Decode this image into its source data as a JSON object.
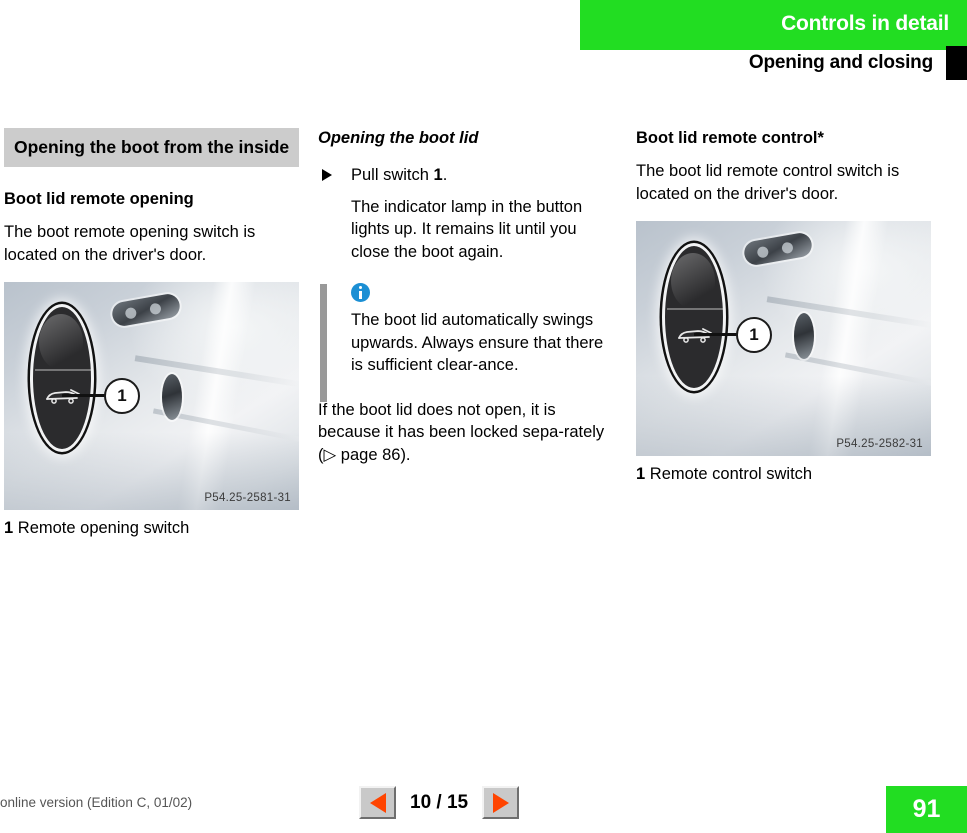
{
  "header": {
    "chapter_title": "Controls in detail",
    "section_title": "Opening and closing",
    "banner_color": "#22dd22"
  },
  "columns": {
    "col1": {
      "boxed_heading": "Opening the boot from the inside",
      "sub_heading": "Boot lid remote opening",
      "paragraph": "The boot remote opening switch is located on the driver's door.",
      "figure": {
        "code": "P54.25-2581-31",
        "callout_number": "1",
        "caption_number": "1",
        "caption_text": "Remote opening switch"
      }
    },
    "col2": {
      "italic_heading": "Opening the boot lid",
      "bullet_text_prefix": "Pull switch ",
      "bullet_callout": "1",
      "bullet_text_suffix": ".",
      "bullet_sub_para": "The indicator lamp in the button lights up. It remains lit until you close the boot again.",
      "note": {
        "icon": "info-icon",
        "text": "The boot lid automatically swings upwards. Always ensure that there is sufficient clear‑ance."
      },
      "closing_paragraph_1": "If the boot lid does not open, it is because it has been locked sepa‑rately (",
      "closing_ref_symbol": "▷",
      "closing_ref_text": " page 86",
      "closing_paragraph_2": ")."
    },
    "col3": {
      "heading": "Boot lid remote control*",
      "paragraph": "The boot lid remote control switch is located on the driver's door.",
      "figure": {
        "code": "P54.25-2582-31",
        "callout_number": "1",
        "caption_number": "1",
        "caption_text": "Remote control switch"
      }
    }
  },
  "footer": {
    "online_note": "online version (Edition C, 01/02)",
    "prev_label": "◀",
    "next_label": "▶",
    "page_count": "10 / 15",
    "page_number": "91",
    "badge_color": "#22dd22",
    "nav_arrow_color": "#ff4400"
  }
}
